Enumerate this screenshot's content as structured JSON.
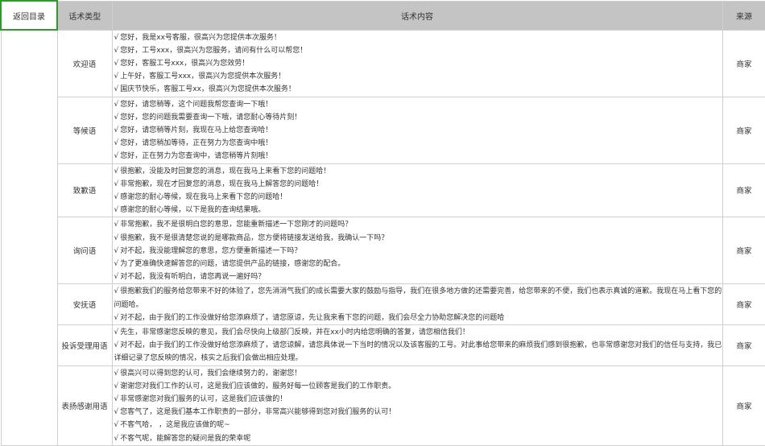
{
  "header": {
    "back_label": "返回目录",
    "type_label": "话术类型",
    "content_label": "话术内容",
    "source_label": "来源"
  },
  "check_mark": "√",
  "rows": [
    {
      "type": "欢迎语",
      "source": "商家",
      "lines": [
        "您好，我是xx号客服，很高兴为您提供本次服务！",
        "您好，工号xxx，很高兴为您服务，请问有什么可以帮您！",
        "您好，客服工号xxx，很高兴为您效劳！",
        "上午好，客服工号xxx，很高兴为您提供本次服务！",
        "国庆节快乐，客服工号xx，很高兴为您提供本次服务！"
      ]
    },
    {
      "type": "等候语",
      "source": "商家",
      "lines": [
        "您好，请您稍等，这个问题我帮您查询一下哦！",
        "您好，您的问题我需要查询一下哦，请您耐心等待片刻！",
        "您好，请您稍等片刻，我现在马上给您查询哈！",
        "您好，请您稍加等待，正在努力为您查询中哦！",
        "您好，正在努力为您查询中，请您稍等片刻哦！"
      ]
    },
    {
      "type": "致歉语",
      "source": "商家",
      "lines": [
        "很抱歉，没能及时回复您的消息，现在我马上来看下您的问题哈！",
        "非常抱歉，现在才回复您的消息，现在我马上解答您的问题哈！",
        "感谢您的耐心等候，现在我马上来看下您的问题哈！",
        "感谢您的耐心等候，以下是我的查询结果哦。"
      ]
    },
    {
      "type": "询问语",
      "source": "商家",
      "lines": [
        "非常抱歉，我不是很明白您的意思，您能重新描述一下您刚才的问题吗？",
        "很抱歉，我不是很清楚您说的是哪款商品，您方便将链接发送给我，我确认一下吗？",
        "对不起，我没能理解您的意思，您方便重新描述一下吗？",
        "为了更准确快速解答您的问题，请您提供产品的链接，感谢您的配合。",
        "对不起，我没有听明白，请您再说一遍好吗？"
      ]
    },
    {
      "type": "安抚语",
      "source": "商家",
      "lines": [
        "很抱歉我们的服务给您带来不好的体验了，您先消消气我们的成长需要大家的鼓励与指导，我们在很多地方做的还需要完善，给您带来的不便，我们也表示真诚的道歉。我现在马上看下您的问题哈。",
        "对不起，由于我们的工作没做好给您添麻烦了，请您原谅，先让我来看下您的问题，我们会尽全力协助您解决您的问题哈"
      ]
    },
    {
      "type": "投诉受理用语",
      "source": "商家",
      "lines": [
        "先生，非常感谢您反映的意见，我们会尽快向上级部门反映，并在xx小时内给您明确的答复，请您相信我们！",
        "对不起，由于我们的工作没做好给您添麻烦了，请您谅解，请您具体说一下当时的情况以及该客服的工号。对此事给您带来的麻烦我们感到很抱歉，也非常感谢您对我们的信任与支持，我已详细记录了您反映的情况，核实之后我们会做出相应处理。"
      ]
    },
    {
      "type": "表扬感谢用语",
      "source": "商家",
      "lines": [
        "很高兴可以得到您的认可，我们会继续努力的，谢谢您！",
        "谢谢您对我们工作的认可，这是我们应该做的，服务好每一位顾客是我们的工作职责。",
        "非常感谢您对我们服务的认可，这是我们应该做的！",
        "您客气了，这是我们基本工作职责的一部分，非常高兴能够得到您对我们服务的认可！",
        "不客气哈， ，这是我应该做的呢~",
        "不客气呢，能解答您的疑问是我的荣幸呢"
      ]
    }
  ]
}
